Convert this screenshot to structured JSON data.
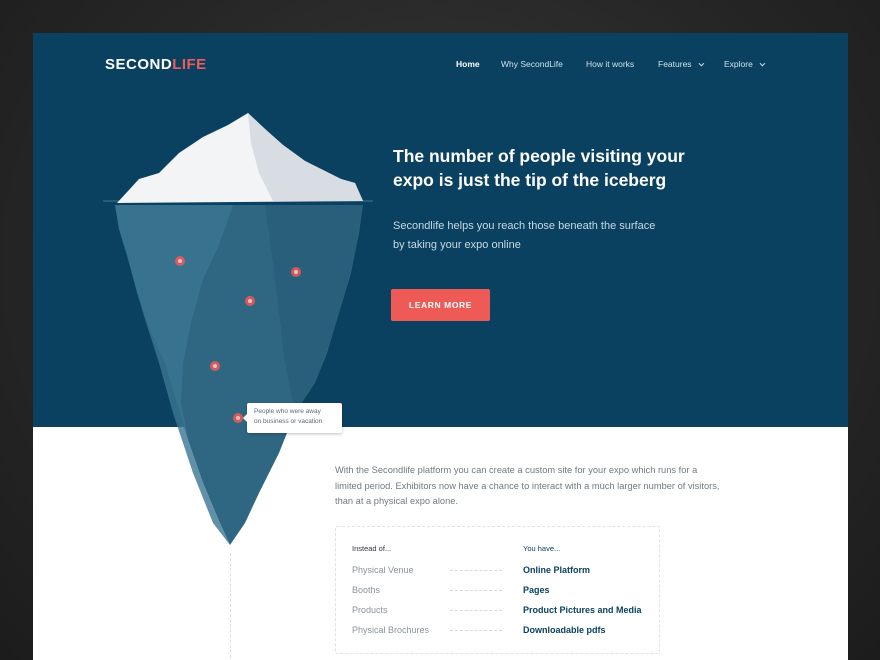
{
  "brand": {
    "part1": "SECOND",
    "part2": "LIFE"
  },
  "nav": {
    "items": [
      {
        "label": "Home"
      },
      {
        "label": "Why SecondLife"
      },
      {
        "label": "How it works"
      },
      {
        "label": "Features"
      },
      {
        "label": "Explore"
      }
    ]
  },
  "hero": {
    "headline": "The number of people visiting your expo is just the tip of the iceberg",
    "subline1": "Secondlife helps you reach those beneath the surface",
    "subline2": "by taking your expo online",
    "cta": "LEARN MORE",
    "tooltip_line1": "People who were away",
    "tooltip_line2": "on business or vacation"
  },
  "intro": {
    "line1": "With the Secondlife platform you can create a custom site for your expo which runs for a",
    "line2": "limited period. Exhibitors now have a chance to interact with a much larger number of visitors,",
    "line3": "than at a physical expo alone."
  },
  "comparison": {
    "left_heading": "Instead of...",
    "right_heading": "You have...",
    "rows": [
      {
        "before": "Physical Venue",
        "after": "Online Platform"
      },
      {
        "before": "Booths",
        "after": "Pages"
      },
      {
        "before": "Products",
        "after": "Product Pictures and Media"
      },
      {
        "before": "Physical Brochures",
        "after": "Downloadable pdfs"
      }
    ]
  },
  "colors": {
    "hero_bg": "#0b4160",
    "accent": "#ef5a5a",
    "iceberg_body": "#2f6783",
    "iceberg_tip": "#f2f4f6"
  }
}
